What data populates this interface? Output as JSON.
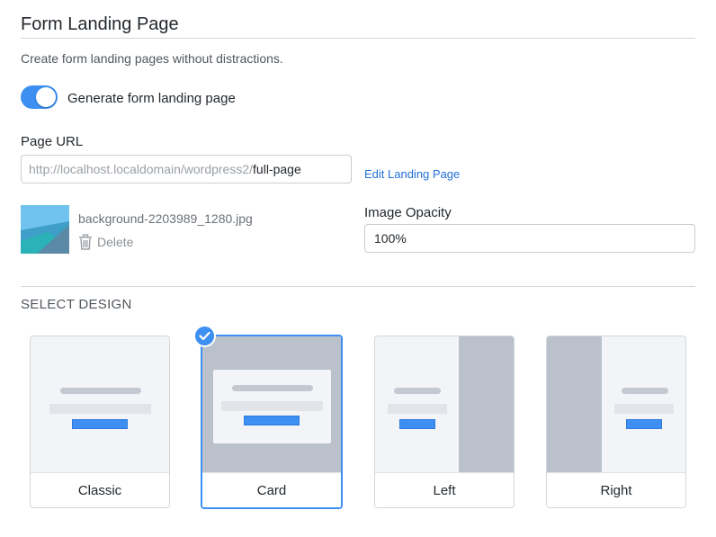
{
  "header": {
    "title": "Form Landing Page",
    "description": "Create form landing pages without distractions."
  },
  "toggle": {
    "label": "Generate form landing page",
    "enabled": true
  },
  "page_url": {
    "label": "Page URL",
    "prefix": "http://localhost.localdomain/wordpress2/",
    "slug": "full-page",
    "edit_link": "Edit Landing Page"
  },
  "background_image": {
    "file_name": "background-2203989_1280.jpg",
    "delete_label": "Delete"
  },
  "image_opacity": {
    "label": "Image Opacity",
    "value": "100%"
  },
  "select_design": {
    "heading": "SELECT DESIGN",
    "selected": "Card",
    "options": [
      {
        "label": "Classic"
      },
      {
        "label": "Card"
      },
      {
        "label": "Left"
      },
      {
        "label": "Right"
      }
    ]
  },
  "colors": {
    "accent": "#3d8ff1",
    "link": "#2271d9",
    "preview_bg": "#f3f4f7",
    "preview_dark": "#bac1cb"
  },
  "icons": {
    "delete": "trash-icon",
    "selected": "checkmark-icon"
  }
}
